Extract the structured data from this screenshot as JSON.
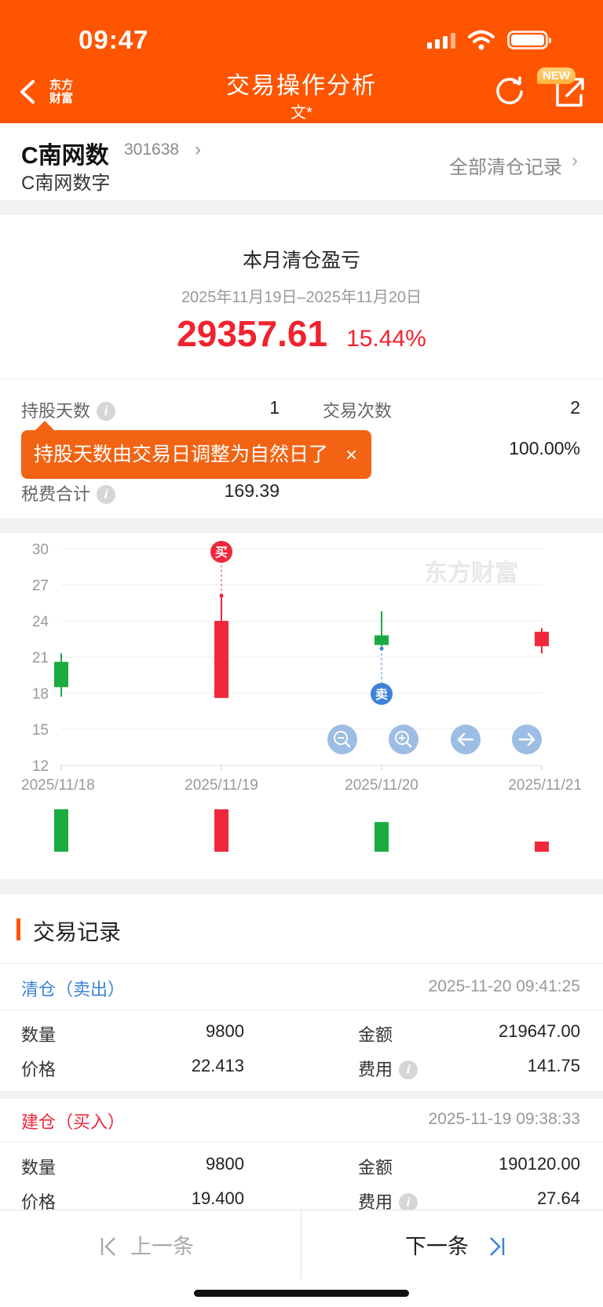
{
  "status_bar": {
    "time": "09:47"
  },
  "nav": {
    "logo_line1": "东方",
    "logo_line2": "财富",
    "title": "交易操作分析",
    "subtitle": "文*",
    "badge": "NEW"
  },
  "stock": {
    "short_name": "C南网数",
    "code": "301638",
    "full_name": "C南网数字",
    "all_records_label": "全部清仓记录"
  },
  "summary": {
    "title": "本月清仓盈亏",
    "date_range": "2025年11月19日–2025年11月20日",
    "profit": "29357.61",
    "profit_pct": "15.44%",
    "stats": {
      "hold_days_label": "持股天数",
      "hold_days": "1",
      "trade_count_label": "交易次数",
      "trade_count": "2",
      "win_rate": "100.00%",
      "fees_label": "税费合计",
      "fees": "169.39"
    },
    "tooltip": "持股天数由交易日调整为自然日了"
  },
  "chart_data": {
    "type": "candlestick",
    "watermark": "东方财富",
    "y_ticks": [
      "30",
      "27",
      "24",
      "21",
      "18",
      "15",
      "12"
    ],
    "ylim": [
      12,
      30
    ],
    "x_labels": [
      "2025/11/18",
      "2025/11/19",
      "2025/11/20",
      "2025/11/21"
    ],
    "candles": [
      {
        "date": "2025/11/18",
        "open": 20.6,
        "close": 18.5,
        "high": 21.3,
        "low": 17.7,
        "color": "#1aab3f"
      },
      {
        "date": "2025/11/19",
        "open": 17.6,
        "close": 24.0,
        "high": 26.1,
        "low": 17.6,
        "color": "#f0283c"
      },
      {
        "date": "2025/11/20",
        "open": 22.8,
        "close": 22.0,
        "high": 24.8,
        "low": 21.9,
        "color": "#1aab3f"
      },
      {
        "date": "2025/11/21",
        "open": 21.9,
        "close": 23.1,
        "high": 23.4,
        "low": 21.3,
        "color": "#f0283c"
      }
    ],
    "volume": [
      {
        "date": "2025/11/18",
        "relative": 1.0,
        "color": "#1aab3f"
      },
      {
        "date": "2025/11/19",
        "relative": 1.0,
        "color": "#f0283c"
      },
      {
        "date": "2025/11/20",
        "relative": 0.7,
        "color": "#1aab3f"
      },
      {
        "date": "2025/11/21",
        "relative": 0.24,
        "color": "#f0283c"
      }
    ],
    "markers": [
      {
        "label": "买",
        "date": "2025/11/19",
        "price": 26.1,
        "color": "#f0283c",
        "position": "above"
      },
      {
        "label": "卖",
        "date": "2025/11/20",
        "price": 21.7,
        "color": "#3c82d8",
        "position": "below"
      }
    ],
    "controls": [
      "zoom-out",
      "zoom-in",
      "left",
      "right"
    ]
  },
  "records": {
    "title": "交易记录",
    "items": [
      {
        "type": "清仓（卖出）",
        "type_color": "#3c82d8",
        "time": "2025-11-20 09:41:25",
        "qty_label": "数量",
        "qty": "9800",
        "amount_label": "金额",
        "amount": "219647.00",
        "price_label": "价格",
        "price": "22.413",
        "fee_label": "费用",
        "fee": "141.75"
      },
      {
        "type": "建仓（买入）",
        "type_color": "#f0283c",
        "time": "2025-11-19 09:38:33",
        "qty_label": "数量",
        "qty": "9800",
        "amount_label": "金额",
        "amount": "190120.00",
        "price_label": "价格",
        "price": "19.400",
        "fee_label": "费用",
        "fee": "27.64"
      }
    ]
  },
  "bottom": {
    "prev_label": "上一条",
    "next_label": "下一条"
  },
  "colors": {
    "brand": "#ff5500",
    "up": "#f0283c",
    "down": "#1aab3f",
    "sell": "#3c82d8"
  }
}
